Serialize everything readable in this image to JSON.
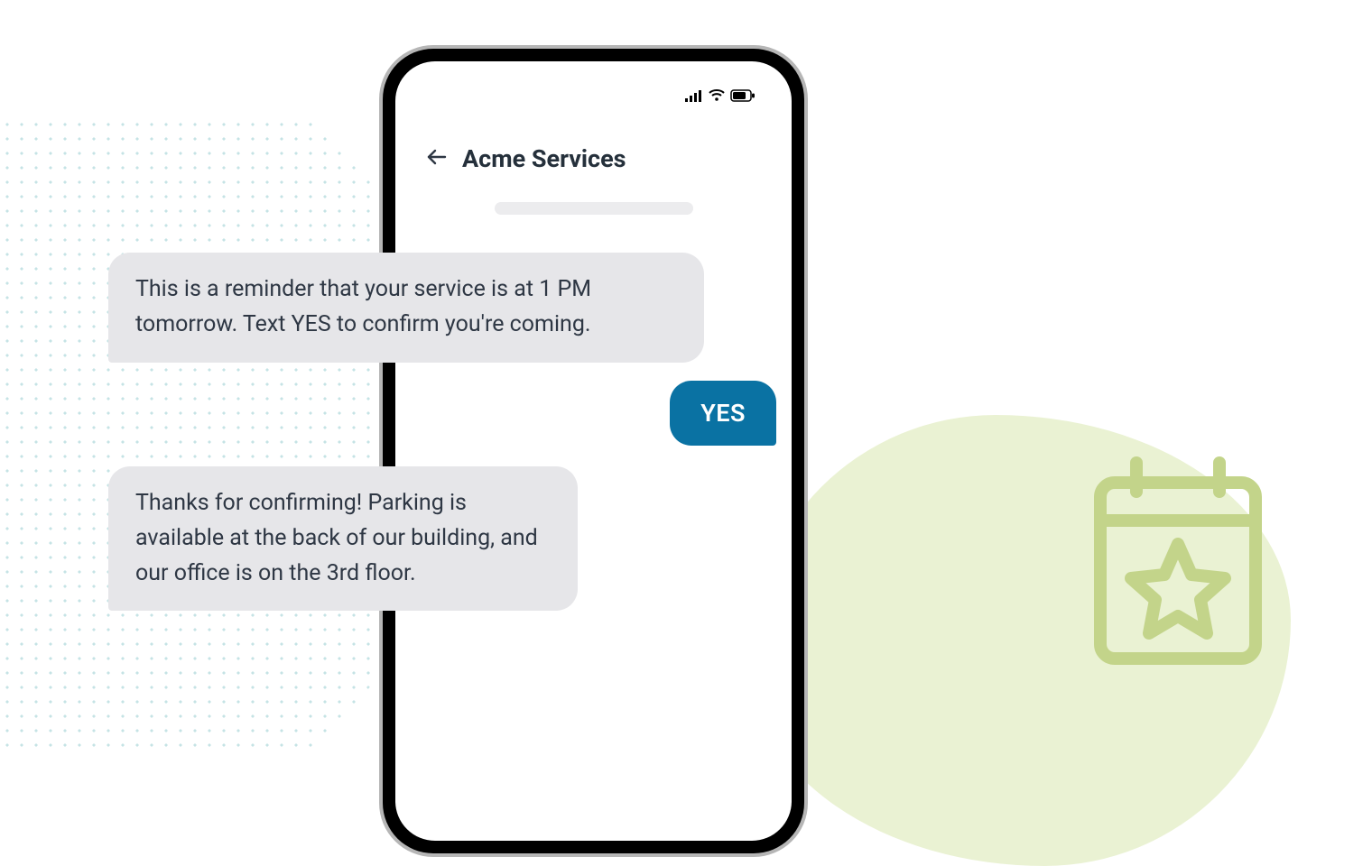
{
  "header": {
    "title": "Acme Services"
  },
  "messages": {
    "received1": "This is a reminder that your service is at 1 PM tomorrow. Text YES to confirm you're coming.",
    "sent1": "YES",
    "received2": "Thanks for confirming! Parking is available at the back of our building, and our office is on the 3rd floor."
  },
  "icons": {
    "back": "back-arrow-icon",
    "signal": "signal-icon",
    "wifi": "wifi-icon",
    "battery": "battery-icon",
    "calendar": "calendar-star-icon"
  },
  "colors": {
    "sent_bubble": "#0a72a3",
    "received_bubble": "#e6e6e9",
    "accent_green": "#c3d48a",
    "dot_color": "#9fd0d4"
  }
}
